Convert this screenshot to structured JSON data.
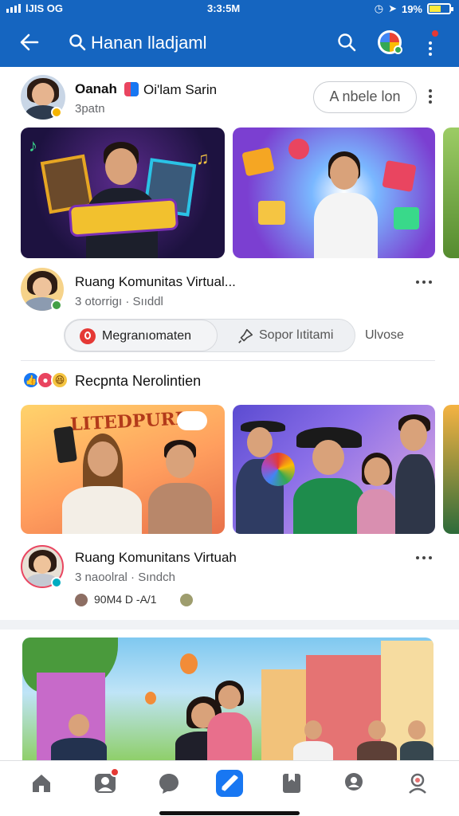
{
  "status_bar": {
    "carrier": "lJIS OG",
    "time": "3:3:5M",
    "battery": "19%"
  },
  "app_bar": {
    "title": "Hanan lladjaml"
  },
  "post1": {
    "name": "Oanah",
    "tag": "Oi'lam Sarin",
    "sub": "3patn",
    "follow_label": "A nbele lon"
  },
  "group1": {
    "name": "Ruang Komunitas Virtual...",
    "sub": "3 otorrigı · Sııddl",
    "chips": {
      "primary": "Megranıomaten",
      "secondary": "Sopor lıtitami",
      "tertiary": "Ulvose"
    }
  },
  "section": {
    "title": "Recpnta Nerolintien"
  },
  "banner_text": "LITEDPURK",
  "group2": {
    "name": "Ruang Komunitans Virtuah",
    "sub": "3 naoolral · Sındch",
    "stats": "90M4  D  -A/1"
  },
  "bottom_nav": {
    "items": [
      "home",
      "friends",
      "messages",
      "feed",
      "saved",
      "groups",
      "profile"
    ],
    "active": "feed"
  },
  "colors": {
    "primary": "#1565c0",
    "accent": "#1877f2"
  }
}
